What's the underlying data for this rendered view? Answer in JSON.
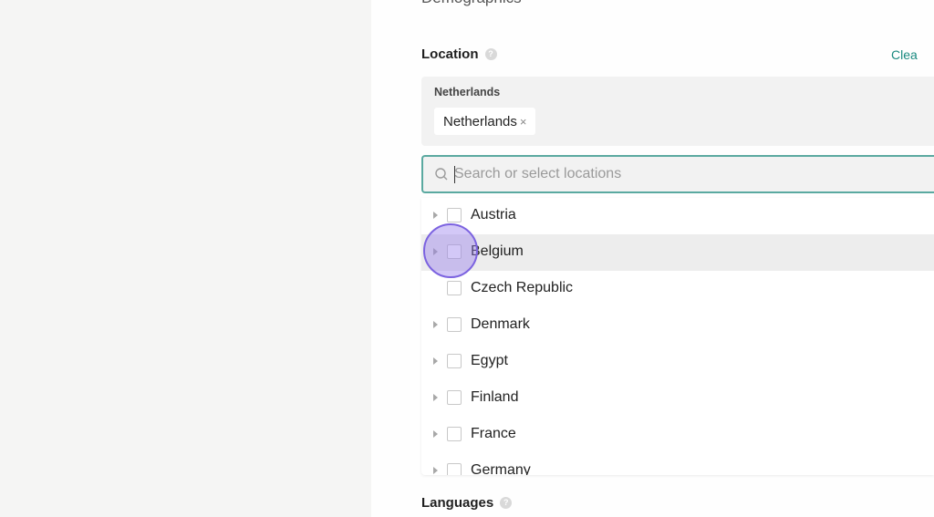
{
  "section": {
    "title": "Demographics"
  },
  "location": {
    "label": "Location",
    "info_icon": "info-circle",
    "clear_label": "Clea",
    "selected_group_label": "Netherlands",
    "chips": [
      {
        "label": "Netherlands",
        "remove_symbol": "×"
      }
    ]
  },
  "search": {
    "placeholder": "Search or select locations",
    "value": "",
    "icon": "search-icon"
  },
  "options": [
    {
      "label": "Austria",
      "expandable": true,
      "checked": false
    },
    {
      "label": "Belgium",
      "expandable": true,
      "checked": false,
      "hovered": true
    },
    {
      "label": "Czech Republic",
      "expandable": false,
      "checked": false
    },
    {
      "label": "Denmark",
      "expandable": true,
      "checked": false
    },
    {
      "label": "Egypt",
      "expandable": true,
      "checked": false
    },
    {
      "label": "Finland",
      "expandable": true,
      "checked": false
    },
    {
      "label": "France",
      "expandable": true,
      "checked": false
    },
    {
      "label": "Germany",
      "expandable": true,
      "checked": false
    }
  ],
  "languages": {
    "label": "Languages"
  },
  "colors": {
    "accent": "#5aa9a0",
    "link": "#1a8a80",
    "cursor": "#7c63e0"
  }
}
